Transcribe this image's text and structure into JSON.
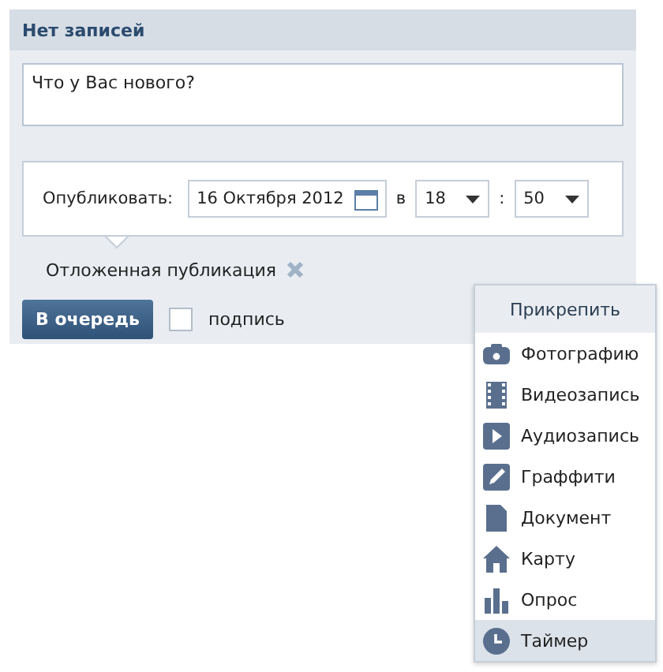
{
  "header": {
    "title": "Нет записей"
  },
  "post_field": {
    "placeholder": "Что у Вас нового?"
  },
  "schedule": {
    "label": "Опубликовать:",
    "date": "16 Октября 2012",
    "at": "в",
    "hour": "18",
    "separator": ":",
    "minute": "50"
  },
  "deferred": {
    "label": "Отложенная публикация"
  },
  "submit_button": "В очередь",
  "signature": {
    "label": "подпись",
    "checked": false
  },
  "attach_menu": {
    "title": "Прикрепить",
    "items": [
      {
        "kind": "photo",
        "label": "Фотографию",
        "selected": false
      },
      {
        "kind": "video",
        "label": "Видеозапись",
        "selected": false
      },
      {
        "kind": "audio",
        "label": "Аудиозапись",
        "selected": false
      },
      {
        "kind": "graffiti",
        "label": "Граффити",
        "selected": false
      },
      {
        "kind": "document",
        "label": "Документ",
        "selected": false
      },
      {
        "kind": "map",
        "label": "Карту",
        "selected": false
      },
      {
        "kind": "poll",
        "label": "Опрос",
        "selected": false
      },
      {
        "kind": "timer",
        "label": "Таймер",
        "selected": true
      }
    ]
  }
}
